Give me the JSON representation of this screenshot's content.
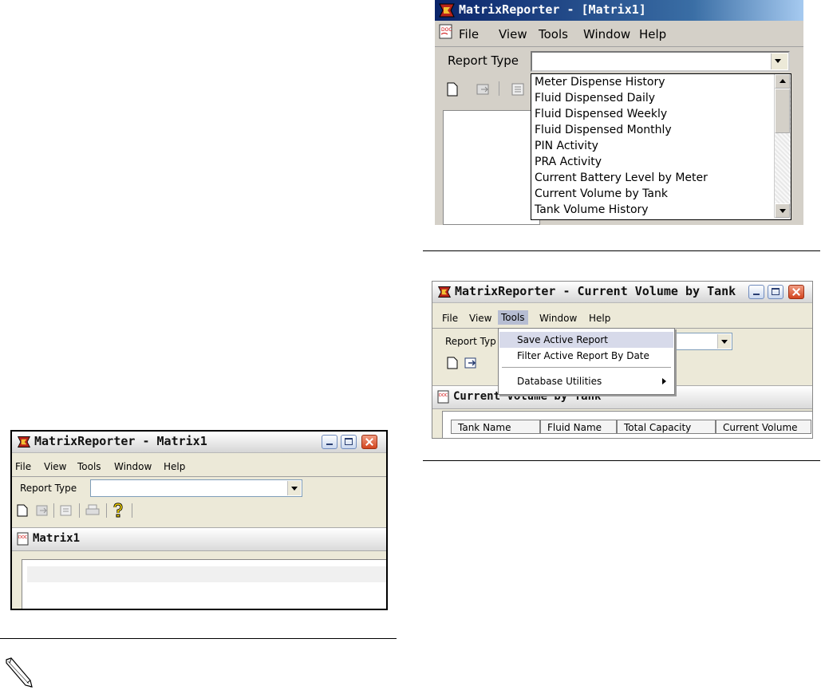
{
  "window_left": {
    "title": "MatrixReporter - Matrix1",
    "menus": [
      "File",
      "View",
      "Tools",
      "Window",
      "Help"
    ],
    "report_type_label": "Report Type",
    "report_type_value": "",
    "document_title": "Matrix1"
  },
  "window_top_right": {
    "title": "MatrixReporter - [Matrix1]",
    "menus": [
      "File",
      "View",
      "Tools",
      "Window",
      "Help"
    ],
    "report_type_label": "Report Type",
    "report_type_value": "",
    "dropdown_options": [
      "Meter Dispense History",
      "Fluid Dispensed Daily",
      "Fluid Dispensed Weekly",
      "Fluid Dispensed Monthly",
      "PIN Activity",
      "PRA Activity",
      "Current Battery Level by Meter",
      "Current Volume by Tank",
      "Tank Volume History"
    ]
  },
  "window_mid_right": {
    "title": "MatrixReporter - Current Volume by Tank",
    "menus": [
      "File",
      "View",
      "Tools",
      "Window",
      "Help"
    ],
    "active_menu": "Tools",
    "report_type_label_truncated": "Report Typ",
    "tools_menu_items": [
      "Save Active Report",
      "Filter Active Report By Date",
      "Database Utilities"
    ],
    "document_title": "Current Volume by Tank",
    "columns": [
      "Tank Name",
      "Fluid Name",
      "Total Capacity",
      "Current Volume"
    ]
  },
  "icons": {
    "pencil": "pencil-note-icon",
    "help": "question-mark-icon"
  }
}
